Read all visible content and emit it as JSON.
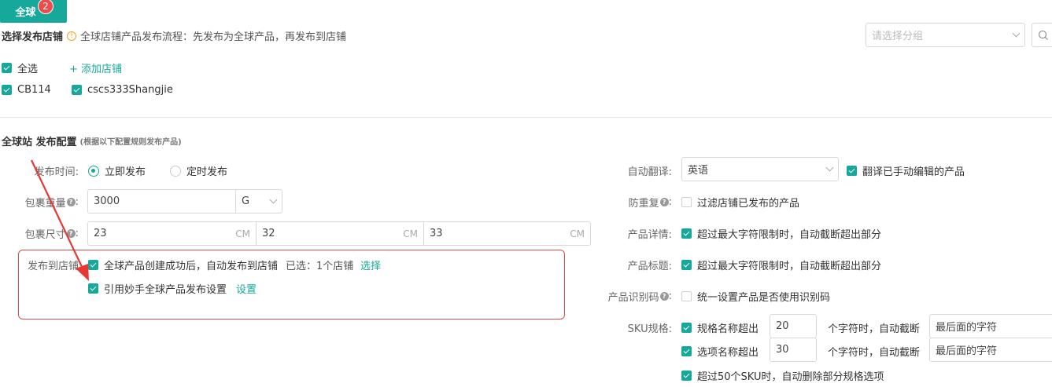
{
  "tab": {
    "label": "全球",
    "badge": "2"
  },
  "header": {
    "title": "选择发布店铺",
    "hint": "全球店铺产品发布流程：先发布为全球产品，再发布到店铺",
    "group_placeholder": "请选择分组"
  },
  "stores": {
    "select_all": "全选",
    "add_store": "+ 添加店铺",
    "items": [
      "CB114",
      "cscs333Shangjie"
    ]
  },
  "config": {
    "title": "全球站 发布配置",
    "subtitle": "(根据以下配置规则发布产品)"
  },
  "left": {
    "publish_time_label": "发布时间:",
    "publish_now": "立即发布",
    "publish_scheduled": "定时发布",
    "weight_label": "包裹重量",
    "weight_value": "3000",
    "weight_unit": "G",
    "size_label": "包裹尺寸",
    "size_values": [
      "23",
      "32",
      "33"
    ],
    "size_unit": "CM",
    "publish_store_label": "发布到店铺",
    "auto_publish": "全球产品创建成功后，自动发布到店铺",
    "selected_text": "已选：1个店铺",
    "select_link": "选择",
    "quote_settings": "引用妙手全球产品发布设置",
    "settings_link": "设置"
  },
  "right": {
    "auto_translate_label": "自动翻译:",
    "language": "英语",
    "translate_edited": "翻译已手动编辑的产品",
    "dedupe_label": "防重复",
    "dedupe_text": "过滤店铺已发布的产品",
    "detail_label": "产品详情:",
    "detail_text": "超过最大字符限制时，自动截断超出部分",
    "title_label": "产品标题:",
    "title_text": "超过最大字符限制时，自动截断超出部分",
    "id_code_label": "产品识别码",
    "id_code_text": "统一设置产品是否使用识别码",
    "sku_label": "SKU规格:",
    "sku_rows": [
      {
        "text": "规格名称超出",
        "value": "20",
        "suffix": "个字符时，自动截断",
        "mode": "最后面的字符"
      },
      {
        "text": "选项名称超出",
        "value": "30",
        "suffix": "个字符时，自动截断",
        "mode": "最后面的字符"
      }
    ],
    "sku_limit_text": "超过50个SKU时，自动删除部分规格选项"
  },
  "colors": {
    "accent": "#16a89a",
    "highlight": "#e04848"
  }
}
